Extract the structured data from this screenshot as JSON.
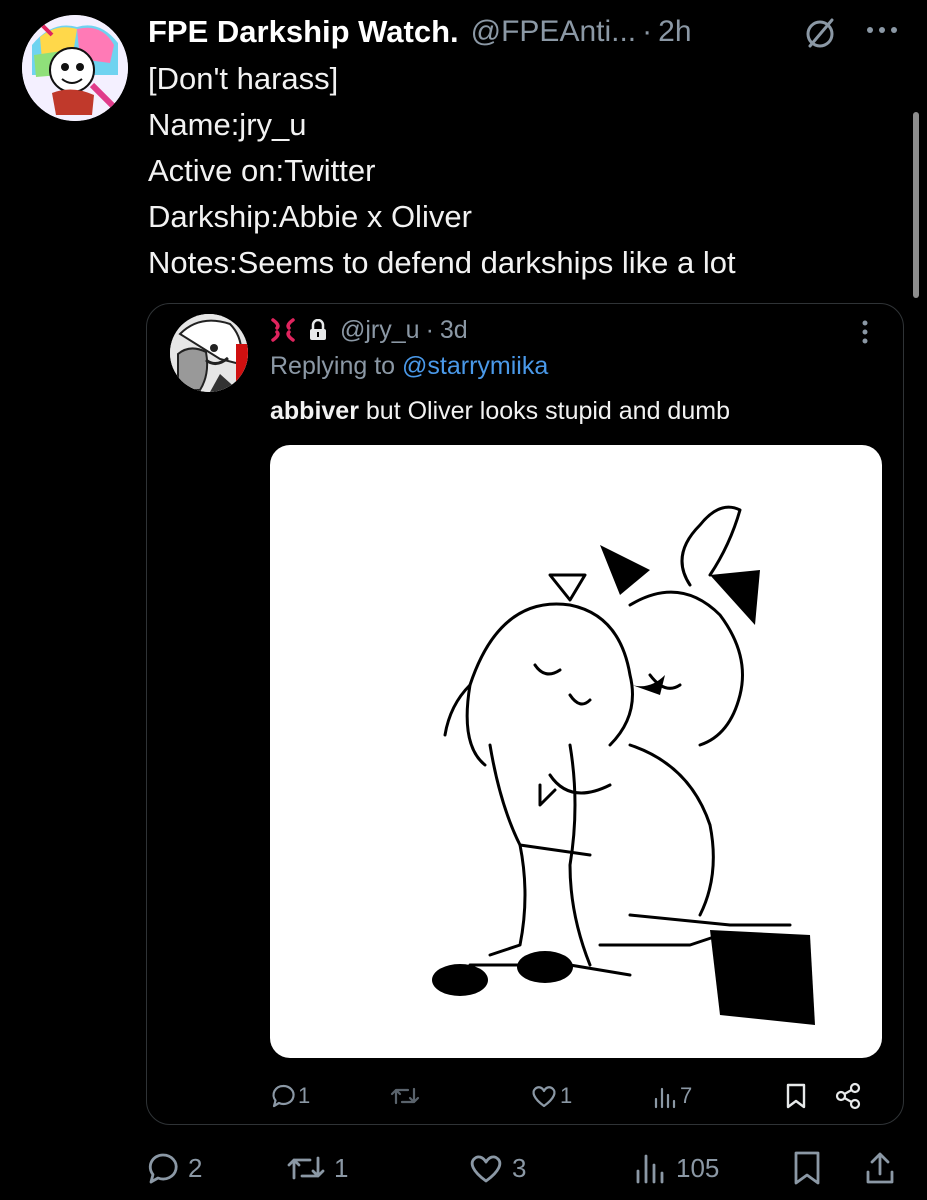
{
  "tweet": {
    "display_name": "FPE Darkship Watch.",
    "handle": "@FPEAnti...",
    "separator": "·",
    "time": "2h",
    "lines": [
      "[Don't harass]",
      "Name:jry_u",
      "Active on:Twitter",
      "Darkship:Abbie x Oliver",
      "Notes:Seems to defend darkships like a lot"
    ]
  },
  "quoted": {
    "handle": "@jry_u",
    "separator": "·",
    "time": "3d",
    "replying_prefix": "Replying to",
    "replying_to": "@starrymiika",
    "text_bold": "abbiver",
    "text_rest": " but Oliver looks stupid and dumb",
    "actions": {
      "replies": "1",
      "retweets": "",
      "likes": "1",
      "views": "7"
    }
  },
  "actions": {
    "replies": "2",
    "retweets": "1",
    "likes": "3",
    "views": "105"
  },
  "icons": {
    "reply": "reply-icon",
    "retweet": "retweet-icon",
    "like": "heart-icon",
    "views": "views-icon",
    "bookmark": "bookmark-icon",
    "share": "share-icon",
    "more": "more-icon",
    "grok": "slash-circle-icon",
    "lock": "lock-icon",
    "emoji": "anger-emoji-icon"
  },
  "colors": {
    "background": "#000000",
    "text": "#e7e9ea",
    "muted": "#8b98a5",
    "link": "#4a99e9",
    "border": "#2f3336",
    "anger_emoji": "#e0245e"
  }
}
